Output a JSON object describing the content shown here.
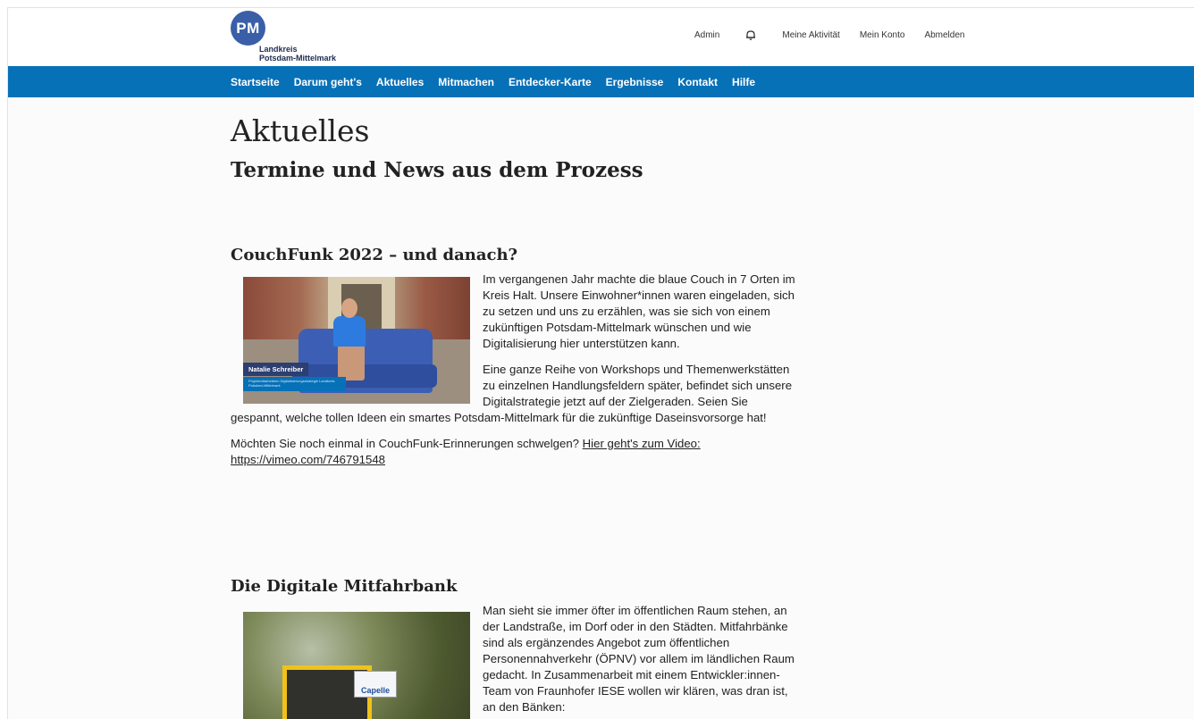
{
  "header": {
    "logo": {
      "initials": "PM",
      "line1": "Landkreis",
      "line2": "Potsdam-Mittelmark"
    },
    "links": {
      "admin": "Admin",
      "activity": "Meine Aktivität",
      "account": "Mein Konto",
      "logout": "Abmelden"
    }
  },
  "nav": {
    "items": [
      "Startseite",
      "Darum geht's",
      "Aktuelles",
      "Mitmachen",
      "Entdecker-Karte",
      "Ergebnisse",
      "Kontakt",
      "Hilfe"
    ]
  },
  "page": {
    "title": "Aktuelles",
    "subtitle": "Termine und News aus dem Prozess"
  },
  "articles": [
    {
      "title": "CouchFunk 2022 – und danach?",
      "image_caption_name": "Natalie Schreiber",
      "image_caption_role": "Projektmitarbeiterin Digitalisierungsstrategie Landkreis Potsdam-Mittelmark",
      "p1": "Im vergangenen Jahr machte die blaue Couch in 7 Orten im Kreis Halt. Unsere Einwohner*innen waren eingeladen, sich zu setzen und uns zu erzählen, was sie sich von einem zukünftigen Potsdam-Mittelmark wünschen und wie Digitalisierung hier unterstützen kann.",
      "p2": "Eine ganze Reihe von Workshops und Themenwerkstätten zu einzelnen Handlungsfeldern später, befindet sich unsere Digitalstrategie jetzt auf der Zielgeraden. Seien Sie gespannt, welche tollen Ideen ein smartes Potsdam-Mittelmark für die zukünftige Daseinsvorsorge hat!",
      "p3_text": "Möchten Sie noch einmal in CouchFunk-Erinnerungen schwelgen? ",
      "p3_link": "Hier geht's zum Video: https://vimeo.com/746791548"
    },
    {
      "title": "Die Digitale Mitfahrbank",
      "image_sign": "Capelle",
      "p1": "Man sieht sie immer öfter im öffentlichen Raum stehen, an der Landstraße, im Dorf oder in den Städten. Mitfahrbänke sind als ergänzendes Angebot zum öffentlichen Personennahverkehr (ÖPNV) vor allem im ländlichen Raum gedacht. In Zusammenarbeit mit einem Entwickler:innen-Team von Fraunhofer IESE wollen wir klären, was dran ist, an den Bänken:"
    }
  ]
}
